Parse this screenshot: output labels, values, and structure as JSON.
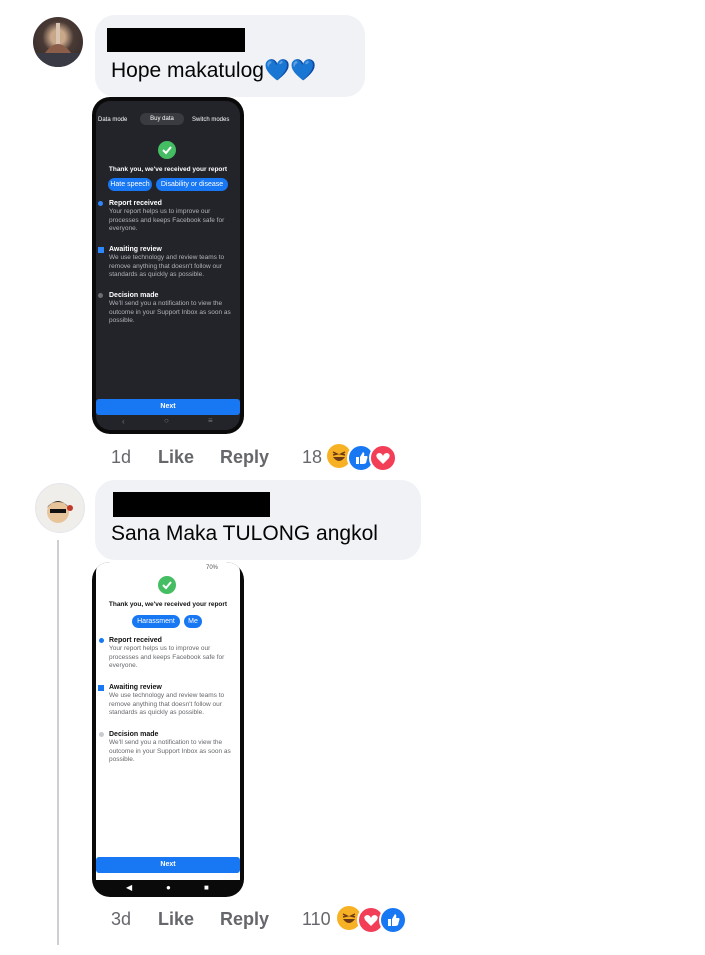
{
  "comments": [
    {
      "text": "Hope makatulog",
      "trailing_emoji": "💙💙",
      "time": "1d",
      "like_label": "Like",
      "reply_label": "Reply",
      "reaction_count": "18",
      "reactions": [
        "haha-icon",
        "like-icon",
        "love-icon"
      ],
      "screenshot": {
        "tabs": [
          "Data mode",
          "Buy data",
          "Switch modes"
        ],
        "title": "Thank you, we've received your report",
        "pills": [
          "Hate speech",
          "Disability or disease"
        ],
        "steps": [
          {
            "title": "Report received",
            "body": "Your report helps us to improve our processes and keeps Facebook safe for everyone."
          },
          {
            "title": "Awaiting review",
            "body": "We use technology and review teams to remove anything that doesn't follow our standards as quickly as possible."
          },
          {
            "title": "Decision made",
            "body": "We'll send you a notification to view the outcome in your Support Inbox as soon as possible."
          }
        ],
        "button": "Next"
      }
    },
    {
      "text": "Sana Maka TULONG angkol",
      "time": "3d",
      "like_label": "Like",
      "reply_label": "Reply",
      "reaction_count": "110",
      "reactions": [
        "haha-icon",
        "love-icon",
        "like-icon"
      ],
      "screenshot": {
        "status": "70%",
        "title": "Thank you, we've received your report",
        "pills": [
          "Harassment",
          "Me"
        ],
        "steps": [
          {
            "title": "Report received",
            "body": "Your report helps us to improve our processes and keeps Facebook safe for everyone."
          },
          {
            "title": "Awaiting review",
            "body": "We use technology and review teams to remove anything that doesn't follow our standards as quickly as possible."
          },
          {
            "title": "Decision made",
            "body": "We'll send you a notification to view the outcome in your Support Inbox as soon as possible."
          }
        ],
        "button": "Next"
      }
    }
  ],
  "colors": {
    "bubble": "#f0f2f5",
    "accent": "#1877f2",
    "meta_text": "#65676b",
    "success": "#45bd62"
  }
}
